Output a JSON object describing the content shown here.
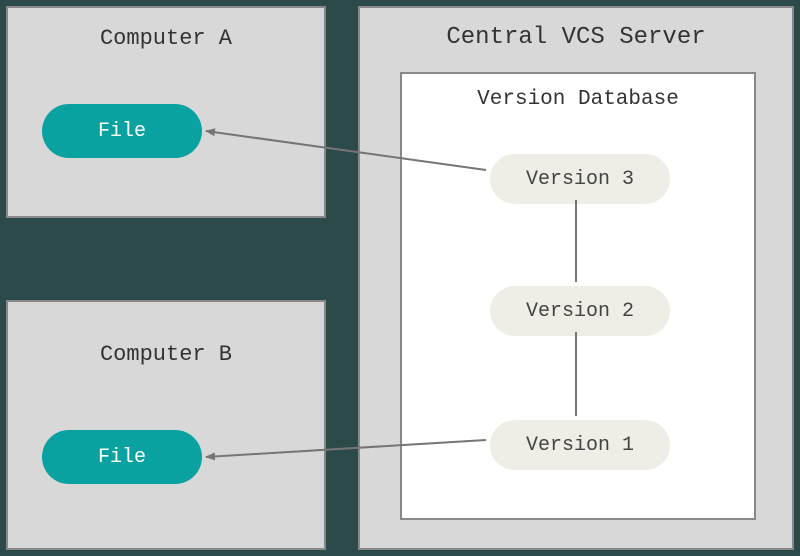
{
  "computerA": {
    "title": "Computer A",
    "file_label": "File"
  },
  "computerB": {
    "title": "Computer B",
    "file_label": "File"
  },
  "server": {
    "title": "Central VCS Server",
    "database": {
      "title": "Version Database",
      "versions": [
        "Version 3",
        "Version 2",
        "Version 1"
      ]
    }
  },
  "colors": {
    "background": "#2d4a4a",
    "box_bg": "#d8d8d8",
    "box_border": "#888888",
    "file_pill": "#0aa1a1",
    "version_pill": "#eeede6",
    "arrow": "#757575"
  }
}
